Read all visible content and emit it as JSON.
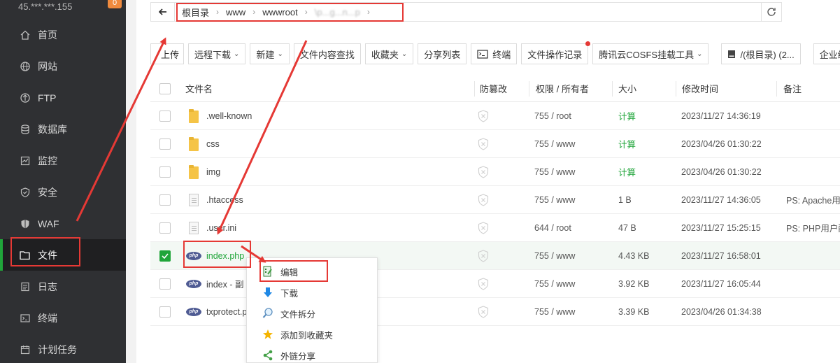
{
  "sidebar": {
    "server_ip": "45.***.***.155",
    "badge": "0",
    "items": [
      {
        "label": "首页",
        "icon": "home-icon"
      },
      {
        "label": "网站",
        "icon": "globe-icon"
      },
      {
        "label": "FTP",
        "icon": "ftp-icon"
      },
      {
        "label": "数据库",
        "icon": "database-icon"
      },
      {
        "label": "监控",
        "icon": "monitor-icon"
      },
      {
        "label": "安全",
        "icon": "shield-icon"
      },
      {
        "label": "WAF",
        "icon": "waf-icon"
      },
      {
        "label": "文件",
        "icon": "folder-icon",
        "active": true
      },
      {
        "label": "日志",
        "icon": "log-icon"
      },
      {
        "label": "终端",
        "icon": "terminal-icon"
      },
      {
        "label": "计划任务",
        "icon": "calendar-icon"
      }
    ]
  },
  "path": {
    "crumbs": [
      "根目录",
      "www",
      "wwwroot",
      "\\p...g...n...p"
    ]
  },
  "toolbar": {
    "upload": "上传",
    "remote_download": "远程下载",
    "new": "新建",
    "content_search": "文件内容查找",
    "favorites": "收藏夹",
    "share_list": "分享列表",
    "terminal": "终端",
    "op_log": "文件操作记录",
    "cosfs": "腾讯云COSFS挂载工具",
    "disk": "/(根目录) (2...",
    "tamper": "企业级防篡改"
  },
  "table": {
    "headers": {
      "name": "文件名",
      "tamper": "防篡改",
      "perm": "权限 / 所有者",
      "size": "大小",
      "mtime": "修改时间",
      "note": "备注"
    },
    "rows": [
      {
        "name": ".well-known",
        "type": "folder",
        "perm": "755 / root",
        "size": "计算",
        "mtime": "2023/11/27 14:36:19",
        "note": ""
      },
      {
        "name": "css",
        "type": "folder",
        "perm": "755 / www",
        "size": "计算",
        "mtime": "2023/04/26 01:30:22",
        "note": ""
      },
      {
        "name": "img",
        "type": "folder",
        "perm": "755 / www",
        "size": "计算",
        "mtime": "2023/04/26 01:30:22",
        "note": ""
      },
      {
        "name": ".htaccess",
        "type": "file",
        "perm": "755 / www",
        "size": "1 B",
        "mtime": "2023/11/27 14:36:05",
        "note": "PS: Apache用..."
      },
      {
        "name": ".user.ini",
        "type": "file",
        "perm": "644 / root",
        "size": "47 B",
        "mtime": "2023/11/27 15:25:15",
        "note": "PS: PHP用户配..."
      },
      {
        "name": "index.php",
        "type": "php",
        "perm": "755 / www",
        "size": "4.43 KB",
        "mtime": "2023/11/27 16:58:01",
        "note": "",
        "selected": true
      },
      {
        "name": "index - 副",
        "type": "php",
        "perm": "755 / www",
        "size": "3.92 KB",
        "mtime": "2023/11/27 16:05:44",
        "note": ""
      },
      {
        "name": "txprotect.p",
        "type": "php",
        "perm": "755 / www",
        "size": "3.39 KB",
        "mtime": "2023/04/26 01:34:38",
        "note": ""
      }
    ]
  },
  "context_menu": {
    "items": [
      {
        "label": "编辑",
        "icon": "edit-icon"
      },
      {
        "label": "下载",
        "icon": "download-icon"
      },
      {
        "label": "文件拆分",
        "icon": "split-icon"
      },
      {
        "label": "添加到收藏夹",
        "icon": "star-icon"
      },
      {
        "label": "外链分享",
        "icon": "share-icon"
      }
    ]
  },
  "colors": {
    "accent": "#20a53a",
    "annotation": "#e53935",
    "sidebar_bg": "#2f3033"
  }
}
